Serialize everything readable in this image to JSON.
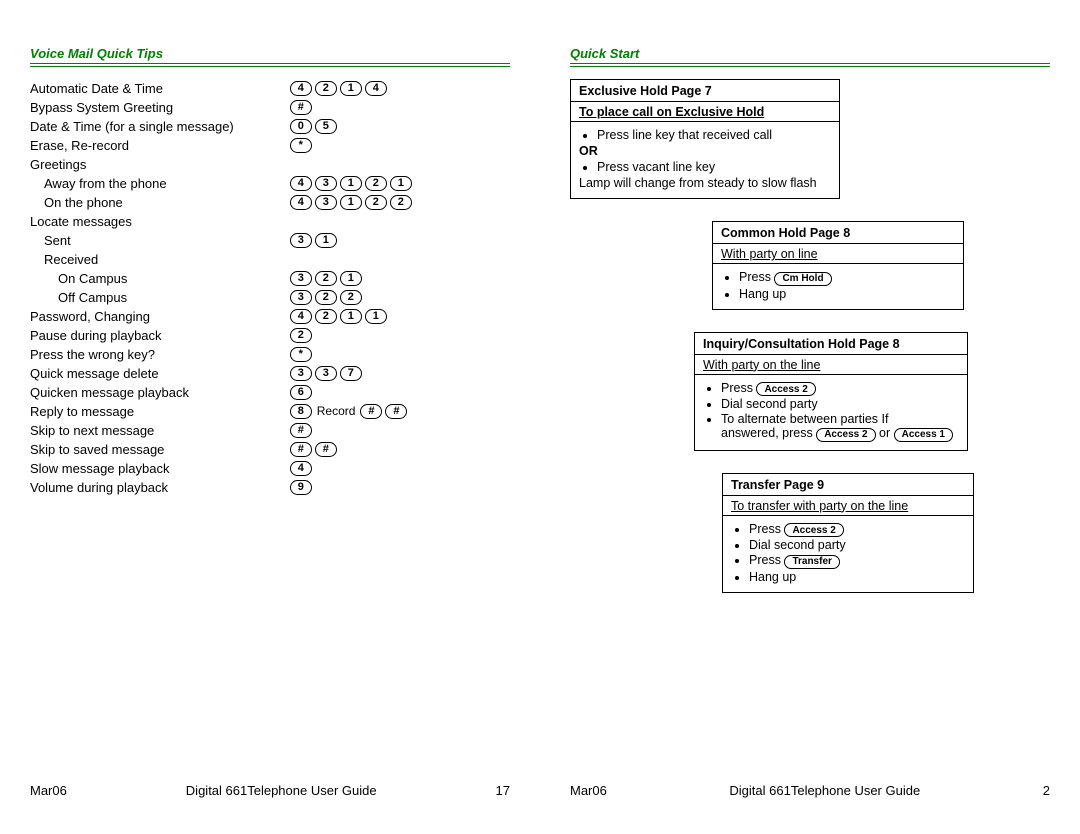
{
  "left": {
    "header": "Voice Mail Quick Tips",
    "tips": {
      "labels": [
        "Automatic Date & Time",
        "Bypass System Greeting",
        "Date & Time (for a single message)",
        "Erase, Re-record",
        "Greetings",
        "Away from the phone",
        "On the phone",
        "Locate messages",
        "Sent",
        "Received",
        "On Campus",
        "Off Campus",
        "Password, Changing",
        "Pause during playback",
        "Press the wrong key?",
        "Quick message delete",
        "Quicken message playback",
        "Reply to message",
        "Skip to next message",
        "Skip to saved message",
        "Slow message playback",
        "Volume during playback"
      ]
    },
    "footer": {
      "date": "Mar06",
      "title": "Digital 661Telephone User Guide",
      "page": "17"
    }
  },
  "right": {
    "header": "Quick Start",
    "box1": {
      "title": "Exclusive Hold Page 7",
      "subtitle": "To place call on Exclusive Hold",
      "li1": "Press line key that received call",
      "or": "OR",
      "li2": "Press vacant line key",
      "tail": "Lamp will change from steady to slow flash"
    },
    "box2": {
      "title": "Common Hold Page 8",
      "subtitle": "With party on line",
      "li1_pre": "Press ",
      "li1_btn": "Cm Hold",
      "li2": "Hang up"
    },
    "box3": {
      "title": "Inquiry/Consultation Hold Page 8",
      "subtitle": "With party on the line",
      "li1_pre": "Press ",
      "li1_btn": "Access 2",
      "li2": "Dial second party",
      "li3a": "To alternate between parties  If",
      "li3b_pre": "answered, press  ",
      "li3b_btn1": "Access 2",
      "li3b_mid": " or ",
      "li3b_btn2": "Access 1"
    },
    "box4": {
      "title": "Transfer Page 9",
      "subtitle": "To transfer with party on the line",
      "li1_pre": "Press ",
      "li1_btn": "Access 2",
      "li2": "Dial second party",
      "li3_pre": "Press ",
      "li3_btn": "Transfer",
      "li4": "Hang up"
    },
    "footer": {
      "date": "Mar06",
      "title": "Digital 661Telephone User Guide",
      "page": "2"
    }
  }
}
